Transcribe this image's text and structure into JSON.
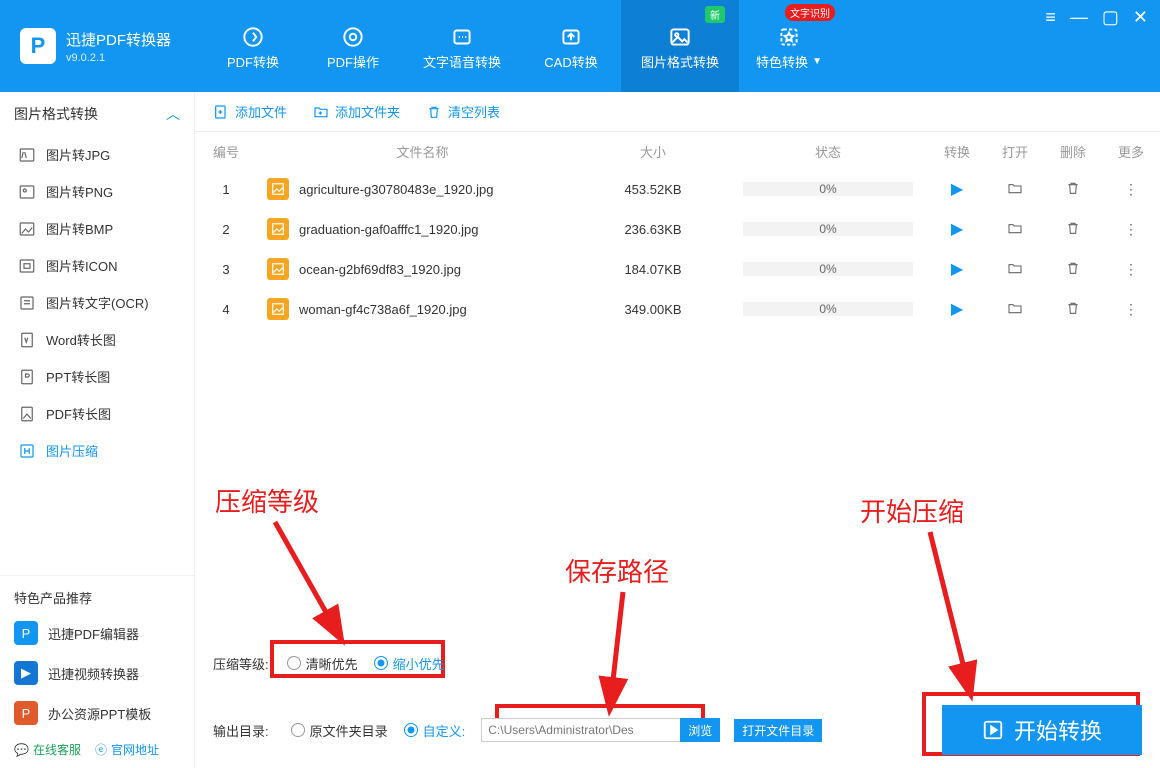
{
  "app": {
    "name": "迅捷PDF转换器",
    "version": "v9.0.2.1"
  },
  "top_tabs": [
    {
      "label": "PDF转换"
    },
    {
      "label": "PDF操作"
    },
    {
      "label": "文字语音转换"
    },
    {
      "label": "CAD转换"
    },
    {
      "label": "图片格式转换",
      "active": true,
      "badge": "新"
    },
    {
      "label": "特色转换",
      "badge_red": "文字识别",
      "dropdown": true
    }
  ],
  "sidebar": {
    "head": "图片格式转换",
    "items": [
      {
        "label": "图片转JPG"
      },
      {
        "label": "图片转PNG"
      },
      {
        "label": "图片转BMP"
      },
      {
        "label": "图片转ICON"
      },
      {
        "label": "图片转文字(OCR)"
      },
      {
        "label": "Word转长图"
      },
      {
        "label": "PPT转长图"
      },
      {
        "label": "PDF转长图"
      },
      {
        "label": "图片压缩",
        "active": true
      }
    ]
  },
  "promo": {
    "head": "特色产品推荐",
    "items": [
      {
        "label": "迅捷PDF编辑器",
        "color": "#1296f2",
        "short": "P"
      },
      {
        "label": "迅捷视频转换器",
        "color": "#1477d4",
        "short": "▶"
      },
      {
        "label": "办公资源PPT模板",
        "color": "#e05a2b",
        "short": "P"
      }
    ]
  },
  "bottom_links": {
    "service": "在线客服",
    "site": "官网地址"
  },
  "toolbar": {
    "add_file": "添加文件",
    "add_folder": "添加文件夹",
    "clear": "清空列表"
  },
  "table": {
    "headers": {
      "num": "编号",
      "name": "文件名称",
      "size": "大小",
      "status": "状态",
      "convert": "转换",
      "open": "打开",
      "delete": "删除",
      "more": "更多"
    },
    "rows": [
      {
        "num": "1",
        "name": "agriculture-g30780483e_1920.jpg",
        "size": "453.52KB",
        "status": "0%"
      },
      {
        "num": "2",
        "name": "graduation-gaf0afffc1_1920.jpg",
        "size": "236.63KB",
        "status": "0%"
      },
      {
        "num": "3",
        "name": "ocean-g2bf69df83_1920.jpg",
        "size": "184.07KB",
        "status": "0%"
      },
      {
        "num": "4",
        "name": "woman-gf4c738a6f_1920.jpg",
        "size": "349.00KB",
        "status": "0%"
      }
    ]
  },
  "annotations": {
    "level": "压缩等级",
    "path": "保存路径",
    "start": "开始压缩"
  },
  "compress": {
    "label": "压缩等级:",
    "clarity": "清晰优先",
    "shrink": "缩小优先"
  },
  "output": {
    "label": "输出目录:",
    "orig": "原文件夹目录",
    "custom": "自定义:",
    "path": "C:\\Users\\Administrator\\Des",
    "browse": "浏览",
    "open_dir": "打开文件目录"
  },
  "start_btn": "开始转换"
}
